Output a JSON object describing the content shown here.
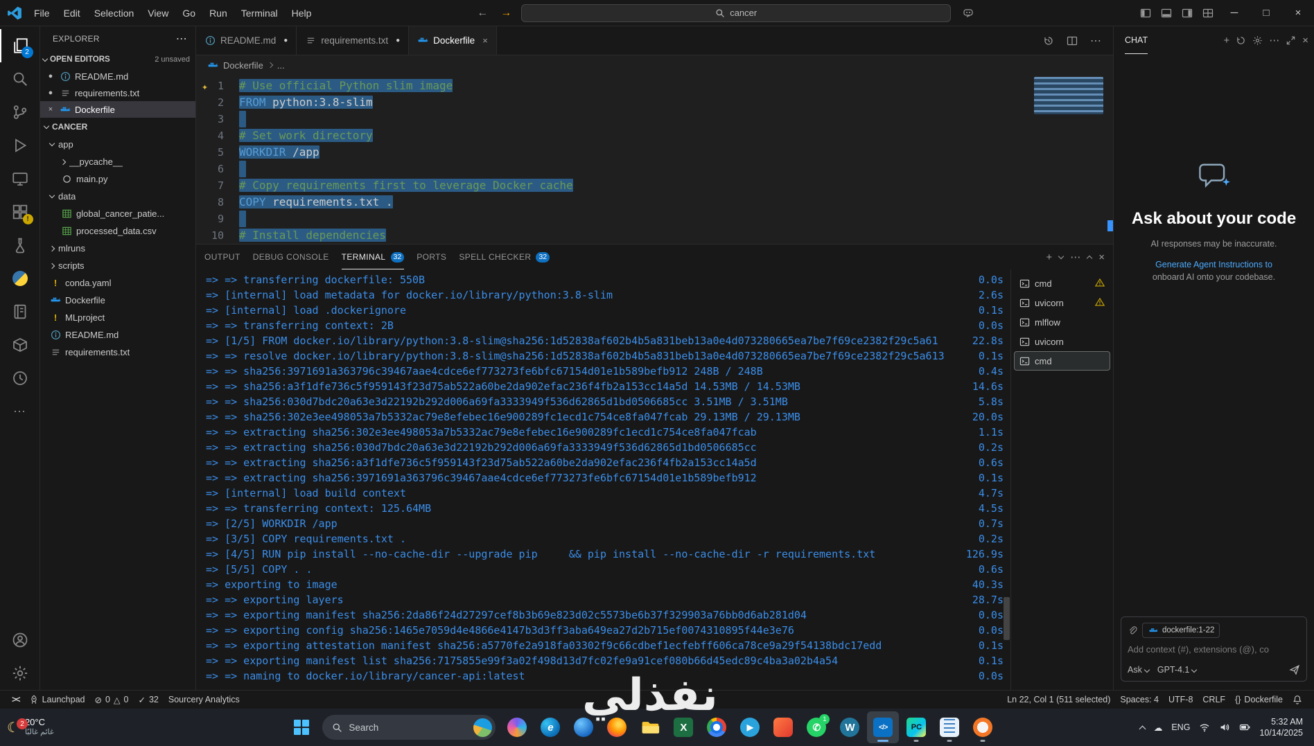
{
  "title_bar": {
    "menus": [
      "File",
      "Edit",
      "Selection",
      "View",
      "Go",
      "Run",
      "Terminal",
      "Help"
    ],
    "search_value": "cancer"
  },
  "activity_bar": {
    "items": [
      {
        "name": "explorer",
        "badge": "2",
        "active": true
      },
      {
        "name": "search"
      },
      {
        "name": "source-control"
      },
      {
        "name": "run-debug"
      },
      {
        "name": "remote-explorer"
      },
      {
        "name": "extensions",
        "warn": "!"
      },
      {
        "name": "testing"
      },
      {
        "name": "python"
      },
      {
        "name": "notebook"
      },
      {
        "name": "containers"
      },
      {
        "name": "history"
      },
      {
        "name": "more"
      }
    ],
    "bottom": [
      {
        "name": "account"
      },
      {
        "name": "settings"
      }
    ]
  },
  "sidebar": {
    "title": "EXPLORER",
    "open_editors": {
      "label": "OPEN EDITORS",
      "badge": "2 unsaved",
      "items": [
        {
          "icon": "info",
          "name": "README.md",
          "modified": true
        },
        {
          "icon": "list",
          "name": "requirements.txt",
          "modified": true
        },
        {
          "icon": "docker",
          "name": "Dockerfile",
          "active": true
        }
      ]
    },
    "tree": {
      "root": "CANCER",
      "items": [
        {
          "label": "app",
          "type": "folder",
          "expanded": true,
          "depth": 0
        },
        {
          "label": "__pycache__",
          "type": "folder",
          "depth": 1
        },
        {
          "label": "main.py",
          "type": "python",
          "depth": 1
        },
        {
          "label": "data",
          "type": "folder",
          "expanded": true,
          "depth": 0
        },
        {
          "label": "global_cancer_patie...",
          "type": "csv",
          "depth": 1
        },
        {
          "label": "processed_data.csv",
          "type": "csv",
          "depth": 1
        },
        {
          "label": "mlruns",
          "type": "folder",
          "depth": 0
        },
        {
          "label": "scripts",
          "type": "folder",
          "depth": 0
        },
        {
          "label": "conda.yaml",
          "type": "yaml",
          "depth": 0
        },
        {
          "label": "Dockerfile",
          "type": "docker",
          "depth": 0
        },
        {
          "label": "MLproject",
          "type": "yaml",
          "depth": 0
        },
        {
          "label": "README.md",
          "type": "info",
          "depth": 0
        },
        {
          "label": "requirements.txt",
          "type": "list",
          "depth": 0
        }
      ]
    }
  },
  "editor": {
    "tabs": [
      {
        "title": "README.md",
        "icon": "info",
        "modified": true
      },
      {
        "title": "requirements.txt",
        "icon": "list",
        "modified": true
      },
      {
        "title": "Dockerfile",
        "icon": "docker",
        "active": true
      }
    ],
    "breadcrumb": {
      "file": "Dockerfile",
      "more": "..."
    },
    "lines": [
      {
        "n": 1,
        "tokens": [
          {
            "s": "# Use official Python slim image",
            "c": "comment"
          }
        ]
      },
      {
        "n": 2,
        "tokens": [
          {
            "s": "FROM",
            "c": "keyword"
          },
          {
            "s": " python:3.8-slim",
            "c": "plain"
          }
        ]
      },
      {
        "n": 3,
        "tokens": []
      },
      {
        "n": 4,
        "tokens": [
          {
            "s": "# Set work directory",
            "c": "comment"
          }
        ]
      },
      {
        "n": 5,
        "tokens": [
          {
            "s": "WORKDIR",
            "c": "keyword"
          },
          {
            "s": " /app",
            "c": "plain"
          }
        ]
      },
      {
        "n": 6,
        "tokens": []
      },
      {
        "n": 7,
        "tokens": [
          {
            "s": "# Copy requirements first to leverage Docker cache",
            "c": "comment"
          }
        ]
      },
      {
        "n": 8,
        "tokens": [
          {
            "s": "COPY",
            "c": "keyword"
          },
          {
            "s": " requirements.txt .",
            "c": "plain"
          }
        ]
      },
      {
        "n": 9,
        "tokens": []
      },
      {
        "n": 10,
        "tokens": [
          {
            "s": "# Install dependencies",
            "c": "comment"
          }
        ]
      }
    ]
  },
  "panel": {
    "tabs": [
      {
        "label": "OUTPUT"
      },
      {
        "label": "DEBUG CONSOLE"
      },
      {
        "label": "TERMINAL",
        "badge": "32",
        "active": true
      },
      {
        "label": "PORTS"
      },
      {
        "label": "SPELL CHECKER",
        "badge": "32"
      }
    ],
    "terminal_lines": [
      {
        "text": "=> => transferring dockerfile: 550B",
        "time": "0.0s"
      },
      {
        "text": "=> [internal] load metadata for docker.io/library/python:3.8-slim",
        "time": "2.6s"
      },
      {
        "text": "=> [internal] load .dockerignore",
        "time": "0.1s"
      },
      {
        "text": "=> => transferring context: 2B",
        "time": "0.0s"
      },
      {
        "text": "=> [1/5] FROM docker.io/library/python:3.8-slim@sha256:1d52838af602b4b5a831beb13a0e4d073280665ea7be7f69ce2382f29c5a61",
        "time": "22.8s"
      },
      {
        "text": "=> => resolve docker.io/library/python:3.8-slim@sha256:1d52838af602b4b5a831beb13a0e4d073280665ea7be7f69ce2382f29c5a613",
        "time": "0.1s"
      },
      {
        "text": "=> => sha256:3971691a363796c39467aae4cdce6ef773273fe6bfc67154d01e1b589befb912 248B / 248B",
        "time": "0.4s"
      },
      {
        "text": "=> => sha256:a3f1dfe736c5f959143f23d75ab522a60be2da902efac236f4fb2a153cc14a5d 14.53MB / 14.53MB",
        "time": "14.6s"
      },
      {
        "text": "=> => sha256:030d7bdc20a63e3d22192b292d006a69fa3333949f536d62865d1bd0506685cc 3.51MB / 3.51MB",
        "time": "5.8s"
      },
      {
        "text": "=> => sha256:302e3ee498053a7b5332ac79e8efebec16e900289fc1ecd1c754ce8fa047fcab 29.13MB / 29.13MB",
        "time": "20.0s"
      },
      {
        "text": "=> => extracting sha256:302e3ee498053a7b5332ac79e8efebec16e900289fc1ecd1c754ce8fa047fcab",
        "time": "1.1s"
      },
      {
        "text": "=> => extracting sha256:030d7bdc20a63e3d22192b292d006a69fa3333949f536d62865d1bd0506685cc",
        "time": "0.2s"
      },
      {
        "text": "=> => extracting sha256:a3f1dfe736c5f959143f23d75ab522a60be2da902efac236f4fb2a153cc14a5d",
        "time": "0.6s"
      },
      {
        "text": "=> => extracting sha256:3971691a363796c39467aae4cdce6ef773273fe6bfc67154d01e1b589befb912",
        "time": "0.1s"
      },
      {
        "text": "=> [internal] load build context",
        "time": "4.7s"
      },
      {
        "text": "=> => transferring context: 125.64MB",
        "time": "4.5s"
      },
      {
        "text": "=> [2/5] WORKDIR /app",
        "time": "0.7s"
      },
      {
        "text": "=> [3/5] COPY requirements.txt .",
        "time": "0.2s"
      },
      {
        "text": "=> [4/5] RUN pip install --no-cache-dir --upgrade pip     && pip install --no-cache-dir -r requirements.txt",
        "time": "126.9s"
      },
      {
        "text": "=> [5/5] COPY . .",
        "time": "0.6s"
      },
      {
        "text": "=> exporting to image",
        "time": "40.3s"
      },
      {
        "text": "=> => exporting layers",
        "time": "28.7s"
      },
      {
        "text": "=> => exporting manifest sha256:2da86f24d27297cef8b3b69e823d02c5573be6b37f329903a76bb0d6ab281d04",
        "time": "0.0s"
      },
      {
        "text": "=> => exporting config sha256:1465e7059d4e4866e4147b3d3ff3aba649ea27d2b715ef0074310895f44e3e76",
        "time": "0.0s"
      },
      {
        "text": "=> => exporting attestation manifest sha256:a5770fe2a918fa03302f9c66cdbef1ecfebff606ca78ce9a29f54138bdc17edd",
        "time": "0.1s"
      },
      {
        "text": "=> => exporting manifest list sha256:7175855e99f3a02f498d13d7fc02fe9a91cef080b66d45edc89c4ba3a02b4a54",
        "time": "0.1s"
      },
      {
        "text": "=> => naming to docker.io/library/cancer-api:latest",
        "time": "0.0s"
      }
    ],
    "sessions": [
      {
        "label": "cmd",
        "warn": true
      },
      {
        "label": "uvicorn",
        "warn": true
      },
      {
        "label": "mlflow"
      },
      {
        "label": "uvicorn"
      },
      {
        "label": "cmd",
        "selected": true
      }
    ]
  },
  "chat": {
    "title": "CHAT",
    "heading": "Ask about your code",
    "disclaimer": "AI responses may be inaccurate.",
    "link": "Generate Agent Instructions to",
    "link_rest": "onboard AI onto your codebase.",
    "attachment": "dockerfile:1-22",
    "placeholder": "Add context (#), extensions (@), co",
    "mode": "Ask",
    "model": "GPT-4.1"
  },
  "status_bar": {
    "remote": "><",
    "launchpad": "Launchpad",
    "errors": "0",
    "warnings": "0",
    "spell": "32",
    "sourcery": "Sourcery Analytics",
    "cursor": "Ln 22, Col 1 (511 selected)",
    "indent": "Spaces: 4",
    "encoding": "UTF-8",
    "eol": "CRLF",
    "language_icon": "{}",
    "language": "Dockerfile"
  },
  "watermark": {
    "text": "نفذلي"
  },
  "taskbar": {
    "weather": {
      "temp": "20°C",
      "desc": "غائم غالبًا",
      "badge": "2"
    },
    "search_label": "Search",
    "apps": [
      {
        "name": "copilot"
      },
      {
        "name": "edge",
        "letter": "e"
      },
      {
        "name": "app-blue"
      },
      {
        "name": "firefox"
      },
      {
        "name": "file-explorer"
      },
      {
        "name": "excel",
        "letter": "X"
      },
      {
        "name": "chrome"
      },
      {
        "name": "telegram",
        "letter": "▶"
      },
      {
        "name": "app-orange"
      },
      {
        "name": "whatsapp",
        "letter": "✆",
        "badge": "1"
      },
      {
        "name": "wordpress",
        "letter": "W"
      },
      {
        "name": "vscode",
        "letter": "</>",
        "running": true,
        "focused": true
      },
      {
        "name": "pycharm",
        "letter": "PC",
        "running": true
      },
      {
        "name": "notepad",
        "running": true
      },
      {
        "name": "jupyter",
        "running": true
      }
    ],
    "tray": {
      "lang": "ENG",
      "time": "5:32 AM",
      "date": "10/14/2025"
    }
  }
}
